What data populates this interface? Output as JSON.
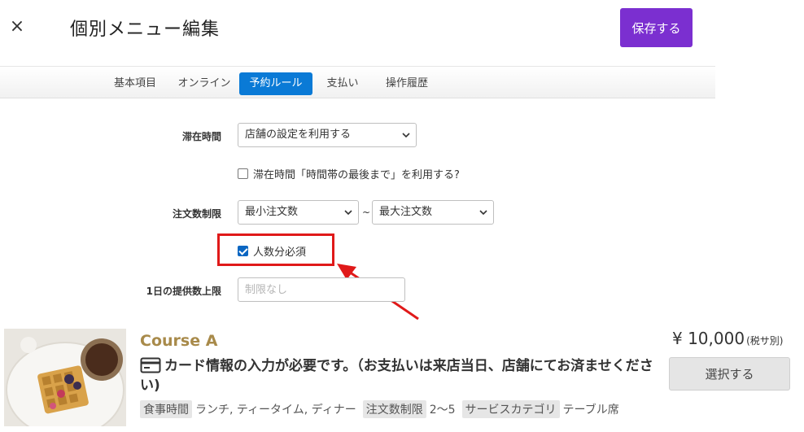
{
  "header": {
    "close_label": "×",
    "title": "個別メニュー編集",
    "save_label": "保存する"
  },
  "tabs": [
    {
      "label": "基本項目",
      "active": false
    },
    {
      "label": "オンライン",
      "active": false
    },
    {
      "label": "予約ルール",
      "active": true
    },
    {
      "label": "支払い",
      "active": false
    },
    {
      "label": "操作履歴",
      "active": false
    }
  ],
  "form": {
    "stay_time": {
      "label": "滞在時間",
      "value": "店舗の設定を利用する",
      "checkbox_label": "滞在時間「時間帯の最後まで」を利用する?",
      "checkbox_checked": false
    },
    "order_limit": {
      "label": "注文数制限",
      "min_value": "最小注文数",
      "separator": "~",
      "max_value": "最大注文数",
      "checkbox_label": "人数分必須",
      "checkbox_checked": true
    },
    "daily_limit": {
      "label": "1日の提供数上限",
      "placeholder": "制限なし"
    }
  },
  "annotation": {
    "highlight_color": "#e01919"
  },
  "course": {
    "name": "Course A",
    "price": "¥ 10,000",
    "tax_note": "(税サ別)",
    "notice": "カード情報の入力が必要です。（お支払いは来店当日、店舗にてお済ませください)",
    "select_label": "選択する",
    "meta": [
      {
        "tag": "食事時間",
        "value": "ランチ, ティータイム, ディナー"
      },
      {
        "tag": "注文数制限",
        "value": "2～5"
      },
      {
        "tag": "サービスカテゴリ",
        "value": "テーブル席"
      }
    ]
  },
  "colors": {
    "accent_purple": "#7b2fd0",
    "tab_active_blue": "#0a7ad6",
    "course_gold": "#a88a4a"
  }
}
